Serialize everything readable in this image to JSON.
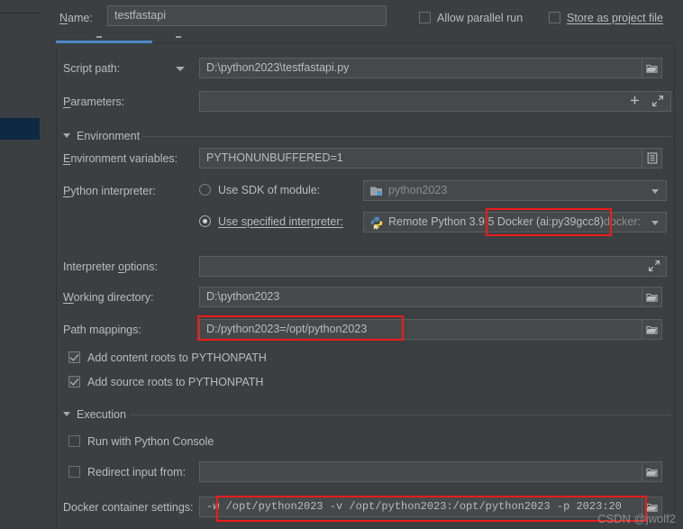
{
  "window": {
    "accent_blue": "#4a88c7",
    "annotation_red": "#ef1b1b",
    "bg": "#3c3f41",
    "field_bg": "#45494a"
  },
  "name_row": {
    "label": "Name:",
    "value": "testfastapi",
    "placeholder": "Name"
  },
  "top_options": {
    "allow_parallel_run": {
      "label": "Allow parallel run",
      "checked": false
    },
    "store_as_project_file": {
      "label": "Store as project file",
      "checked": false
    },
    "gear_icon": "gear-icon"
  },
  "configuration": {
    "script_path": {
      "label": "Script path:",
      "value": "D:\\python2023\\testfastapi.py",
      "browse_icon": "folder-icon"
    },
    "parameters": {
      "label": "Parameters:",
      "value": "",
      "placeholder": "",
      "add_icon": "plus-icon",
      "expand_icon": "expand-icon"
    }
  },
  "environment": {
    "title": "Environment",
    "environment_variables": {
      "label": "Environment variables:",
      "value": "PYTHONUNBUFFERED=1",
      "edit_icon": "list-edit-icon"
    },
    "python_interpreter": {
      "label": "Python interpreter:",
      "use_sdk_of_module": {
        "label": "Use SDK of module:",
        "selected": false,
        "value": "python2023",
        "icon": "module-icon"
      },
      "use_specified_interpreter": {
        "label": "Use specified interpreter:",
        "selected": true,
        "value": "Remote Python 3.9.5 Docker (ai:py39gcc8)",
        "suffix": "docker:",
        "icon": "python-remote-icon"
      }
    },
    "interpreter_options": {
      "label": "Interpreter options:",
      "value": "",
      "expand_icon": "expand-icon"
    },
    "working_directory": {
      "label": "Working directory:",
      "value": "D:\\python2023",
      "browse_icon": "folder-icon"
    },
    "path_mappings": {
      "label": "Path mappings:",
      "value": "D:/python2023=/opt/python2023",
      "browse_icon": "folder-icon"
    },
    "add_content_roots": {
      "label": "Add content roots to PYTHONPATH",
      "checked": true
    },
    "add_source_roots": {
      "label": "Add source roots to PYTHONPATH",
      "checked": true
    }
  },
  "execution": {
    "title": "Execution",
    "run_with_python_console": {
      "label": "Run with Python Console",
      "checked": false
    },
    "redirect_input_from": {
      "label": "Redirect input from:",
      "checked": false,
      "value": "",
      "browse_icon": "folder-icon"
    },
    "docker_container_settings": {
      "label": "Docker container settings:",
      "value": "-w /opt/python2023 -v /opt/python2023:/opt/python2023 -p 2023:20",
      "browse_icon": "folder-icon"
    }
  },
  "annotations": {
    "interpreter_highlight": "Remote Python 3.9.5 Docker (ai:py39gcc8)",
    "path_mappings_highlight": "D:/python2023=/opt/python2023",
    "docker_settings_highlight": "-w /opt/python2023 -v /opt/python2023:/opt/python2023 -p 2023:20"
  },
  "watermark": {
    "text": "CSDN @jwolf2"
  }
}
